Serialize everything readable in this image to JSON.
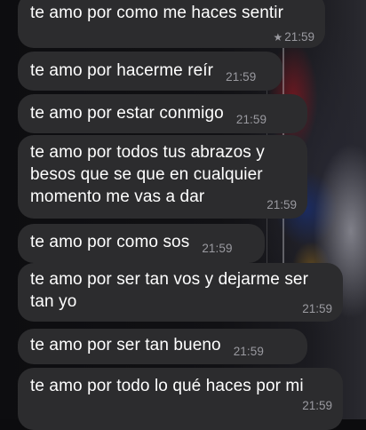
{
  "messages": [
    {
      "text": "te amo por como me haces sentir",
      "time": "21:59",
      "starred": true
    },
    {
      "text": "te amo por hacerme reír",
      "time": "21:59"
    },
    {
      "text": "te amo por estar conmigo",
      "time": "21:59"
    },
    {
      "text": "te amo por todos tus abrazos y\nbesos que se que en cualquier\nmomento me vas a dar",
      "time": "21:59"
    },
    {
      "text": "te amo por como sos",
      "time": "21:59"
    },
    {
      "text": "te amo por ser tan vos y dejarme ser\ntan yo",
      "time": "21:59"
    },
    {
      "text": "te amo por ser tan bueno",
      "time": "21:59"
    },
    {
      "text": "te amo por todo lo qué haces por mi",
      "time": "21:59"
    }
  ],
  "colors": {
    "bubble": "#2c2c2e",
    "text": "#ffffff",
    "timestamp": "#9a9aa0"
  },
  "icons": {
    "starred": "star-icon"
  }
}
